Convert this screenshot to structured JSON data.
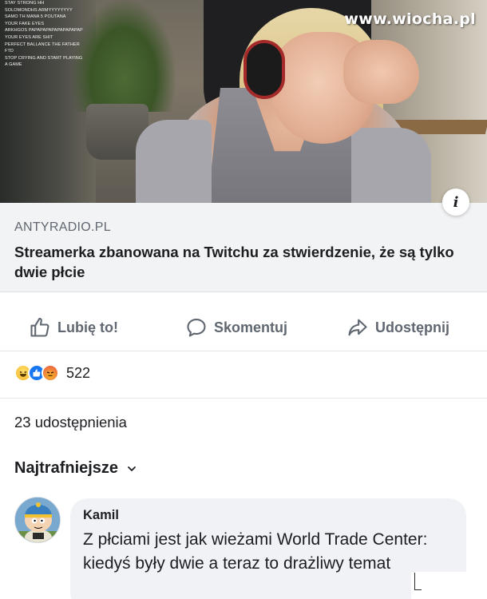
{
  "hero": {
    "watermark": "www.wiocha.pl",
    "chat_lines": [
      {
        "who": "",
        "text": "stay strong hh"
      },
      {
        "who": "",
        "text": "SOLOMONDHS ARMYYYYYYYY"
      },
      {
        "who": "",
        "text": "SAMO TH MANA 5 POUTANA"
      },
      {
        "who": "",
        "text": "YOUR FAKE EYES"
      },
      {
        "who": "",
        "text": "ARKHGOS PAPAPAPAPAPAPAPAPAP"
      },
      {
        "who": "",
        "text": "Your eyes are shit"
      },
      {
        "who": "",
        "text": "perfect ballance the father"
      },
      {
        "who": "",
        "text": "FTD"
      },
      {
        "who": "",
        "text": "STOP CRYING AND START PLAYING"
      },
      {
        "who": "",
        "text": "A GAME"
      }
    ],
    "info_icon_glyph": "i"
  },
  "link": {
    "domain": "ANTYRADIO.PL",
    "title": "Streamerka zbanowana na Twitchu za stwierdzenie, że są tylko dwie płcie"
  },
  "actions": {
    "like_label": "Lubię to!",
    "comment_label": "Skomentuj",
    "share_label": "Udostępnij"
  },
  "reactions": {
    "icons": [
      "haha-icon",
      "like-icon",
      "angry-icon"
    ],
    "count": "522"
  },
  "shares": {
    "text": "23 udostępnienia"
  },
  "comments": {
    "sort_label": "Najtrafniejsze",
    "items": [
      {
        "author": "Kamil",
        "text": "Z płciami jest jak  wieżami World Trade Center: kiedyś były dwie a teraz to drażliwy temat"
      }
    ]
  },
  "colors": {
    "card_background": "#f2f3f5",
    "bubble_background": "#f0f2f5",
    "secondary_text": "#606770",
    "like_blue": "#1877f2"
  }
}
